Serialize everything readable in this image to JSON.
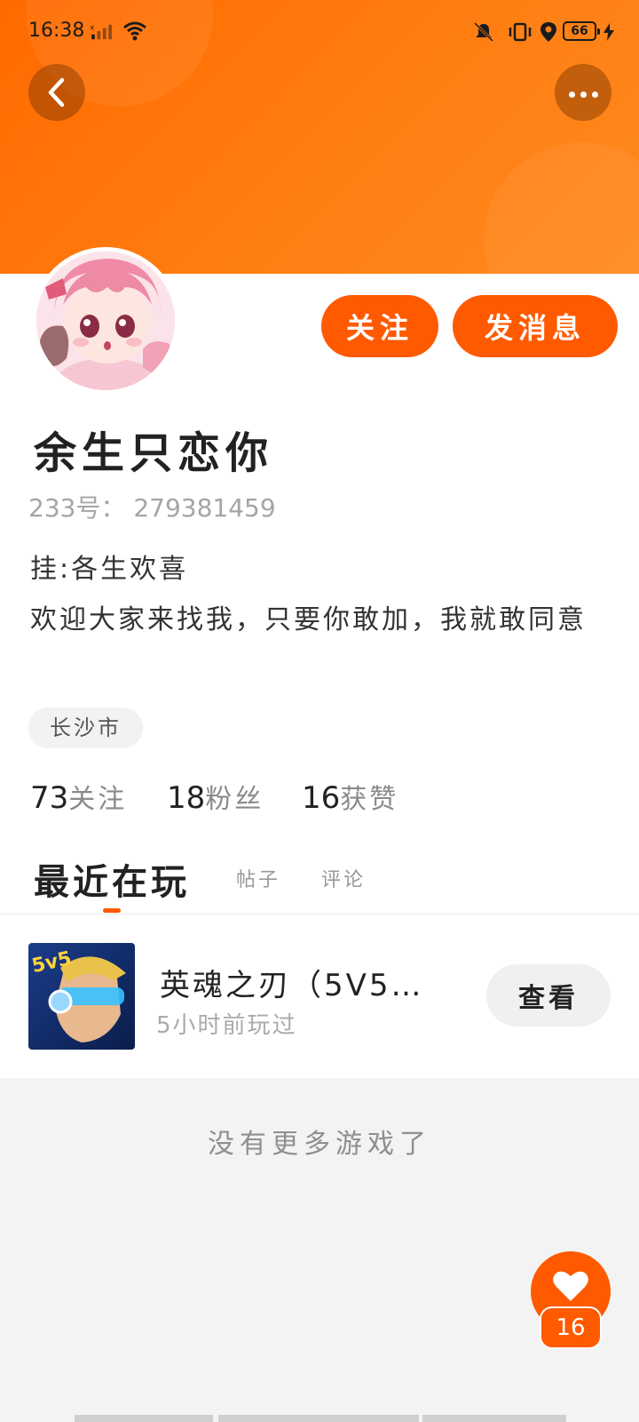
{
  "status_bar": {
    "time": "16:38",
    "battery": "66"
  },
  "header": {
    "back_icon": "chevron-left-icon",
    "more_icon": "more-horizontal-icon"
  },
  "profile": {
    "name": "余生只恋你",
    "uid": "233号： 279381459",
    "bio_line1": "挂:各生欢喜",
    "bio_line2": "欢迎大家来找我，只要你敢加，我就敢同意",
    "location": "长沙市",
    "follow_button": "关注",
    "message_button": "发消息",
    "stats": [
      {
        "count": "73",
        "label": "关注"
      },
      {
        "count": "18",
        "label": "粉丝"
      },
      {
        "count": "16",
        "label": "获赞"
      }
    ]
  },
  "tabs": [
    {
      "label": "最近在玩",
      "active": true
    },
    {
      "label": "帖子",
      "active": false
    },
    {
      "label": "评论",
      "active": false
    }
  ],
  "games": [
    {
      "title": "英魂之刃（5V5…",
      "subtitle": "5小时前玩过",
      "action": "查看",
      "icon_text": "5v5"
    }
  ],
  "empty_note": "没有更多游戏了",
  "like": {
    "count": "16",
    "icon": "heart-icon"
  },
  "colors": {
    "accent": "#ff5a00",
    "header_gradient_start": "#ff6a00",
    "header_gradient_end": "#ff8a1f"
  }
}
